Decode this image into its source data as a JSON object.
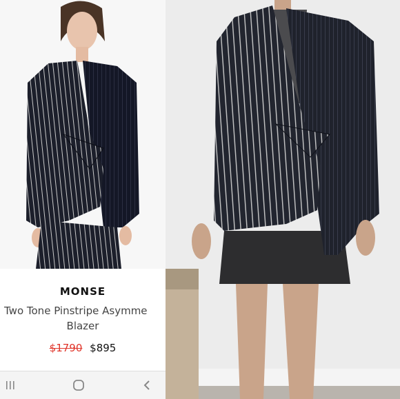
{
  "product": {
    "brand": "MONSE",
    "name_line1": "Two Tone Pinstripe Asymme",
    "name_line2": "Blazer",
    "old_price": "$1790",
    "new_price": "$895"
  },
  "nav": {
    "recent_icon": "recent-apps-icon",
    "home_icon": "home-icon",
    "back_icon": "back-icon"
  },
  "colors": {
    "sale_red": "#e0362b",
    "jacket_navy": "#1c2030"
  }
}
